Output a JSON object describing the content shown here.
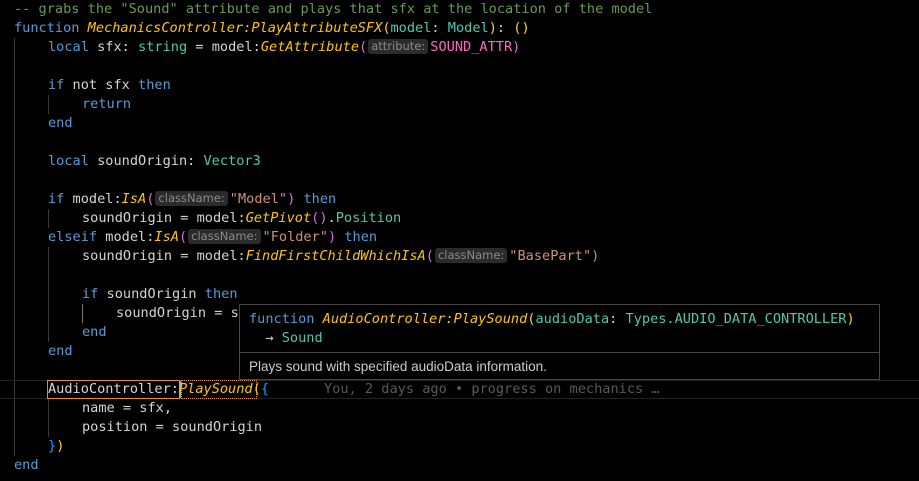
{
  "editor": {
    "lines": {
      "l1": {
        "comment": "-- grabs the \"Sound\" attribute and plays that sfx at the location of the model"
      },
      "l2": {
        "kw": "function",
        "fn": "MechanicsController:PlayAttributeSFX",
        "p_open": "(",
        "param": "model",
        "colon": ": ",
        "type": "Model",
        "p_close": ")",
        "ret": ": ",
        "unit": "()"
      },
      "l3": {
        "kw": "local",
        "name": " sfx",
        "colon": ": ",
        "type": "string",
        "eq": " = model:",
        "fn": "GetAttribute",
        "p_open": "(",
        "inlay": "attribute:",
        "const": "SOUND_ATTR",
        "p_close": ")"
      },
      "l4": {
        "kw": "if",
        "rest": " not sfx ",
        "kw2": "then"
      },
      "l5": {
        "kw": "return"
      },
      "l6": {
        "kw": "end"
      },
      "l7": {
        "kw": "local",
        "rest": " soundOrigin: ",
        "type": "Vector3"
      },
      "l8": {
        "kw": "if",
        "rest": " model:",
        "fn": "IsA",
        "p_open": "(",
        "inlay": "className:",
        "str": "\"Model\"",
        "p_close": ")",
        "kw2": " then"
      },
      "l9": {
        "rest": "soundOrigin = model:",
        "fn": "GetPivot",
        "p": "()",
        "dot": ".",
        "prop": "Position"
      },
      "l10": {
        "kw": "elseif",
        "rest": " model:",
        "fn": "IsA",
        "p_open": "(",
        "inlay": "className:",
        "str": "\"Folder\"",
        "p_close": ")",
        "kw2": " then"
      },
      "l11": {
        "rest": "soundOrigin = model:",
        "fn": "FindFirstChildWhichIsA",
        "p_open": "(",
        "inlay": "className:",
        "str": "\"BasePart\"",
        "p_close": ")"
      },
      "l12": {
        "kw": "if",
        "rest": " soundOrigin ",
        "kw2": "then"
      },
      "l13": {
        "rest": "soundOrigin = s"
      },
      "l14": {
        "kw": "end"
      },
      "l15": {
        "kw": "end"
      },
      "l16": {
        "obj": "AudioController",
        "colon": ":",
        "fn": "PlaySound",
        "p_open": "(",
        "b_open": "{",
        "blame": "You, 2 days ago • progress on mechanics …"
      },
      "l17": {
        "rest": "name = sfx,"
      },
      "l18": {
        "rest": "position = soundOrigin"
      },
      "l19": {
        "b_close": "}",
        "p_close": ")"
      },
      "l20": {
        "kw": "end"
      }
    }
  },
  "hover": {
    "kw": "function",
    "fn": "AudioController:PlaySound",
    "p_open": "(",
    "param": "audioData",
    "colon": ": ",
    "type": "Types.AUDIO_DATA_CONTROLLER",
    "p_close": ")",
    "arrow": "  → ",
    "ret": "Sound",
    "doc": "Plays sound with specified audioData information."
  },
  "colors": {
    "keyword": "#569cd6",
    "function": "#ffc600",
    "comment": "#6a9955",
    "string": "#ce9178",
    "type": "#4ec9b0",
    "selection_border": "#f08a24"
  }
}
